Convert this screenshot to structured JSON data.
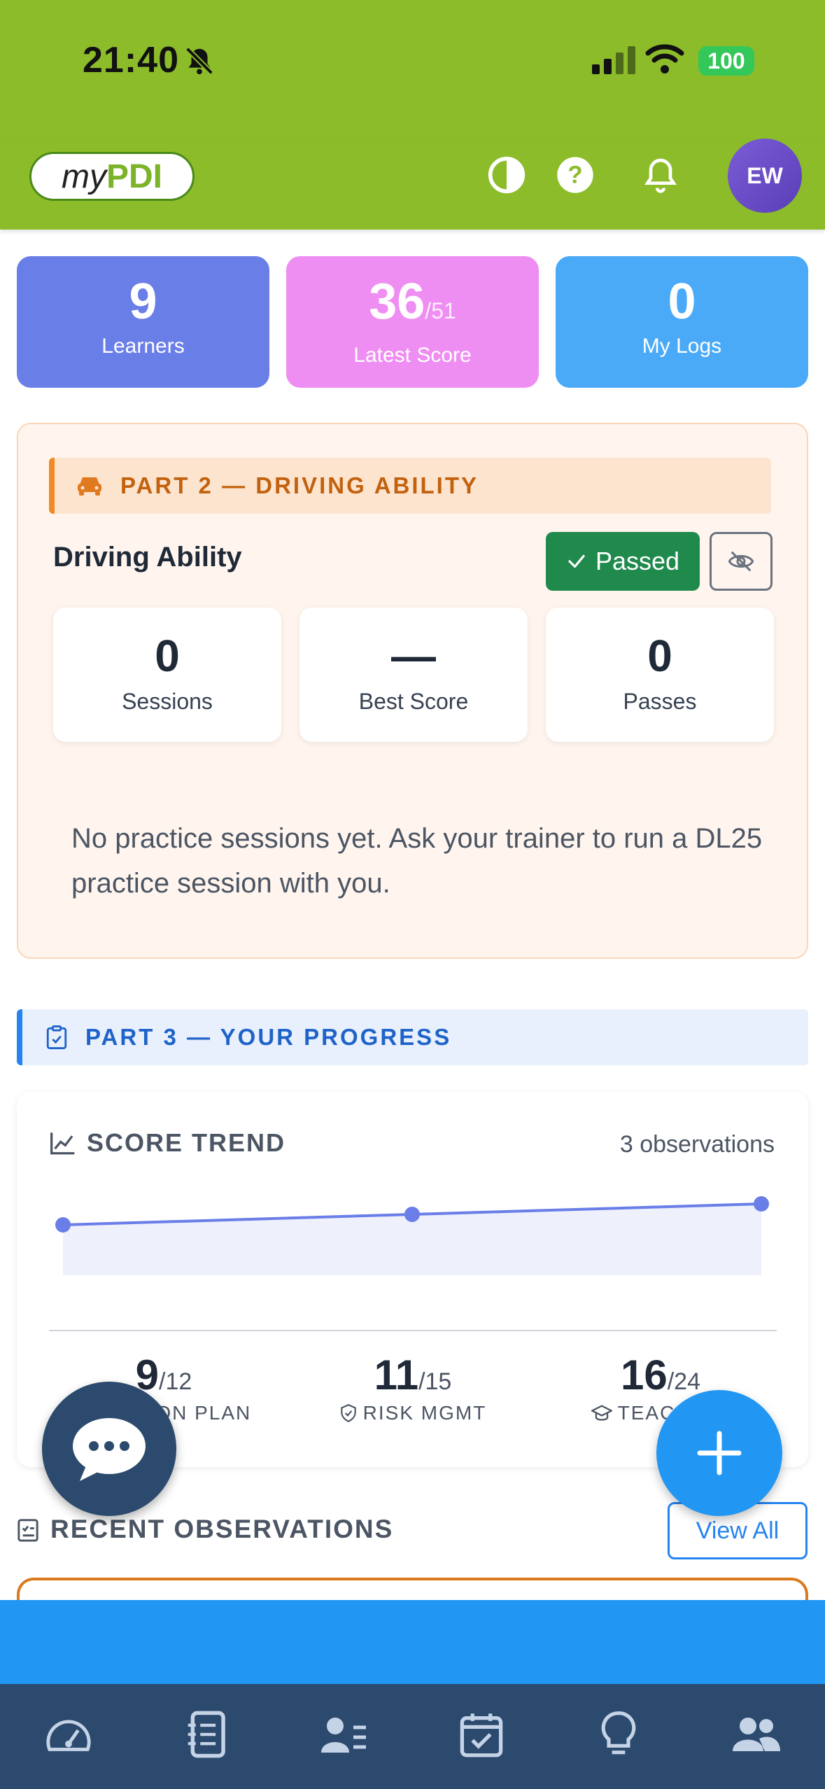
{
  "status_bar": {
    "time": "21:40",
    "battery": "100"
  },
  "header": {
    "logo_my": "my",
    "logo_pdi": "PDI",
    "avatar_initials": "EW"
  },
  "stats": [
    {
      "value": "9",
      "suffix": "",
      "label": "Learners",
      "color": "#6a7ee8"
    },
    {
      "value": "36",
      "suffix": "/51",
      "label": "Latest Score",
      "color": "#ef8ef2"
    },
    {
      "value": "0",
      "suffix": "",
      "label": "My Logs",
      "color": "#4aaaf8"
    }
  ],
  "part2": {
    "banner": "PART 2 — DRIVING ABILITY",
    "title": "Driving Ability",
    "passed_label": "Passed",
    "metrics": [
      {
        "value": "0",
        "label": "Sessions"
      },
      {
        "value": "—",
        "label": "Best Score"
      },
      {
        "value": "0",
        "label": "Passes"
      }
    ],
    "empty_message": "No practice sessions yet. Ask your trainer to run a DL25 practice session with you."
  },
  "part3": {
    "banner": "PART 3 — YOUR PROGRESS",
    "trend_title": "SCORE TREND",
    "observations_count": "3 observations",
    "sub_scores": [
      {
        "value": "9",
        "max": "/12",
        "label": "LESSON PLAN",
        "icon": "clipboard-icon"
      },
      {
        "value": "11",
        "max": "/15",
        "label": "RISK MGMT",
        "icon": "shield-icon"
      },
      {
        "value": "16",
        "max": "/24",
        "label": "TEACHING",
        "icon": "graduation-cap-icon"
      }
    ]
  },
  "chart_data": {
    "type": "area",
    "title": "SCORE TREND",
    "x": [
      1,
      2,
      3
    ],
    "values": [
      33,
      34.5,
      36
    ],
    "ylim": [
      20,
      40
    ],
    "grid": false,
    "color": "#6a7ee8"
  },
  "recent": {
    "title": "RECENT OBSERVATIONS",
    "view_all": "View All"
  },
  "nav": [
    "dashboard-icon",
    "notes-icon",
    "learners-icon",
    "calendar-icon",
    "tips-icon",
    "community-icon"
  ]
}
